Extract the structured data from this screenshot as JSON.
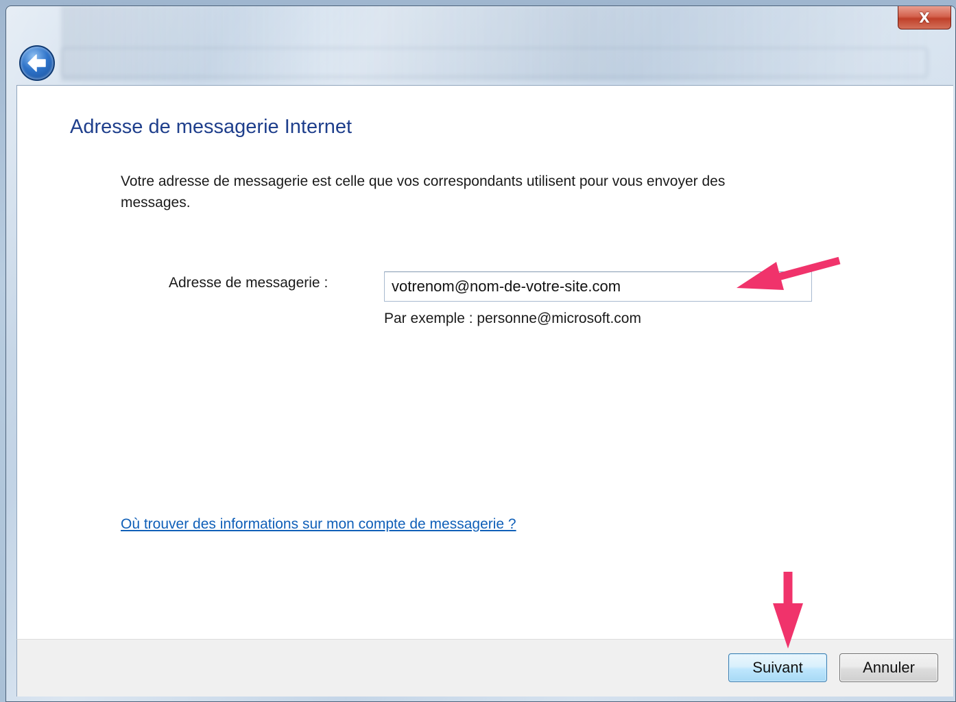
{
  "window": {
    "close_glyph": "X"
  },
  "page": {
    "title": "Adresse de messagerie Internet",
    "intro": "Votre adresse de messagerie est celle que vos correspondants utilisent pour vous envoyer des messages."
  },
  "form": {
    "email_label": "Adresse de messagerie :",
    "email_value": "votrenom@nom-de-votre-site.com",
    "example_text": "Par exemple : personne@microsoft.com"
  },
  "help_link": "Où trouver des informations sur mon compte de messagerie ?",
  "buttons": {
    "next": "Suivant",
    "cancel": "Annuler"
  },
  "icons": {
    "back": "back-arrow-icon",
    "close": "close-icon",
    "annotation": "pink-arrow-icon"
  },
  "colors": {
    "title": "#1f3f8c",
    "link": "#0f5fb8",
    "annotation_arrow": "#f0336b",
    "close_button": "#c9462f"
  }
}
